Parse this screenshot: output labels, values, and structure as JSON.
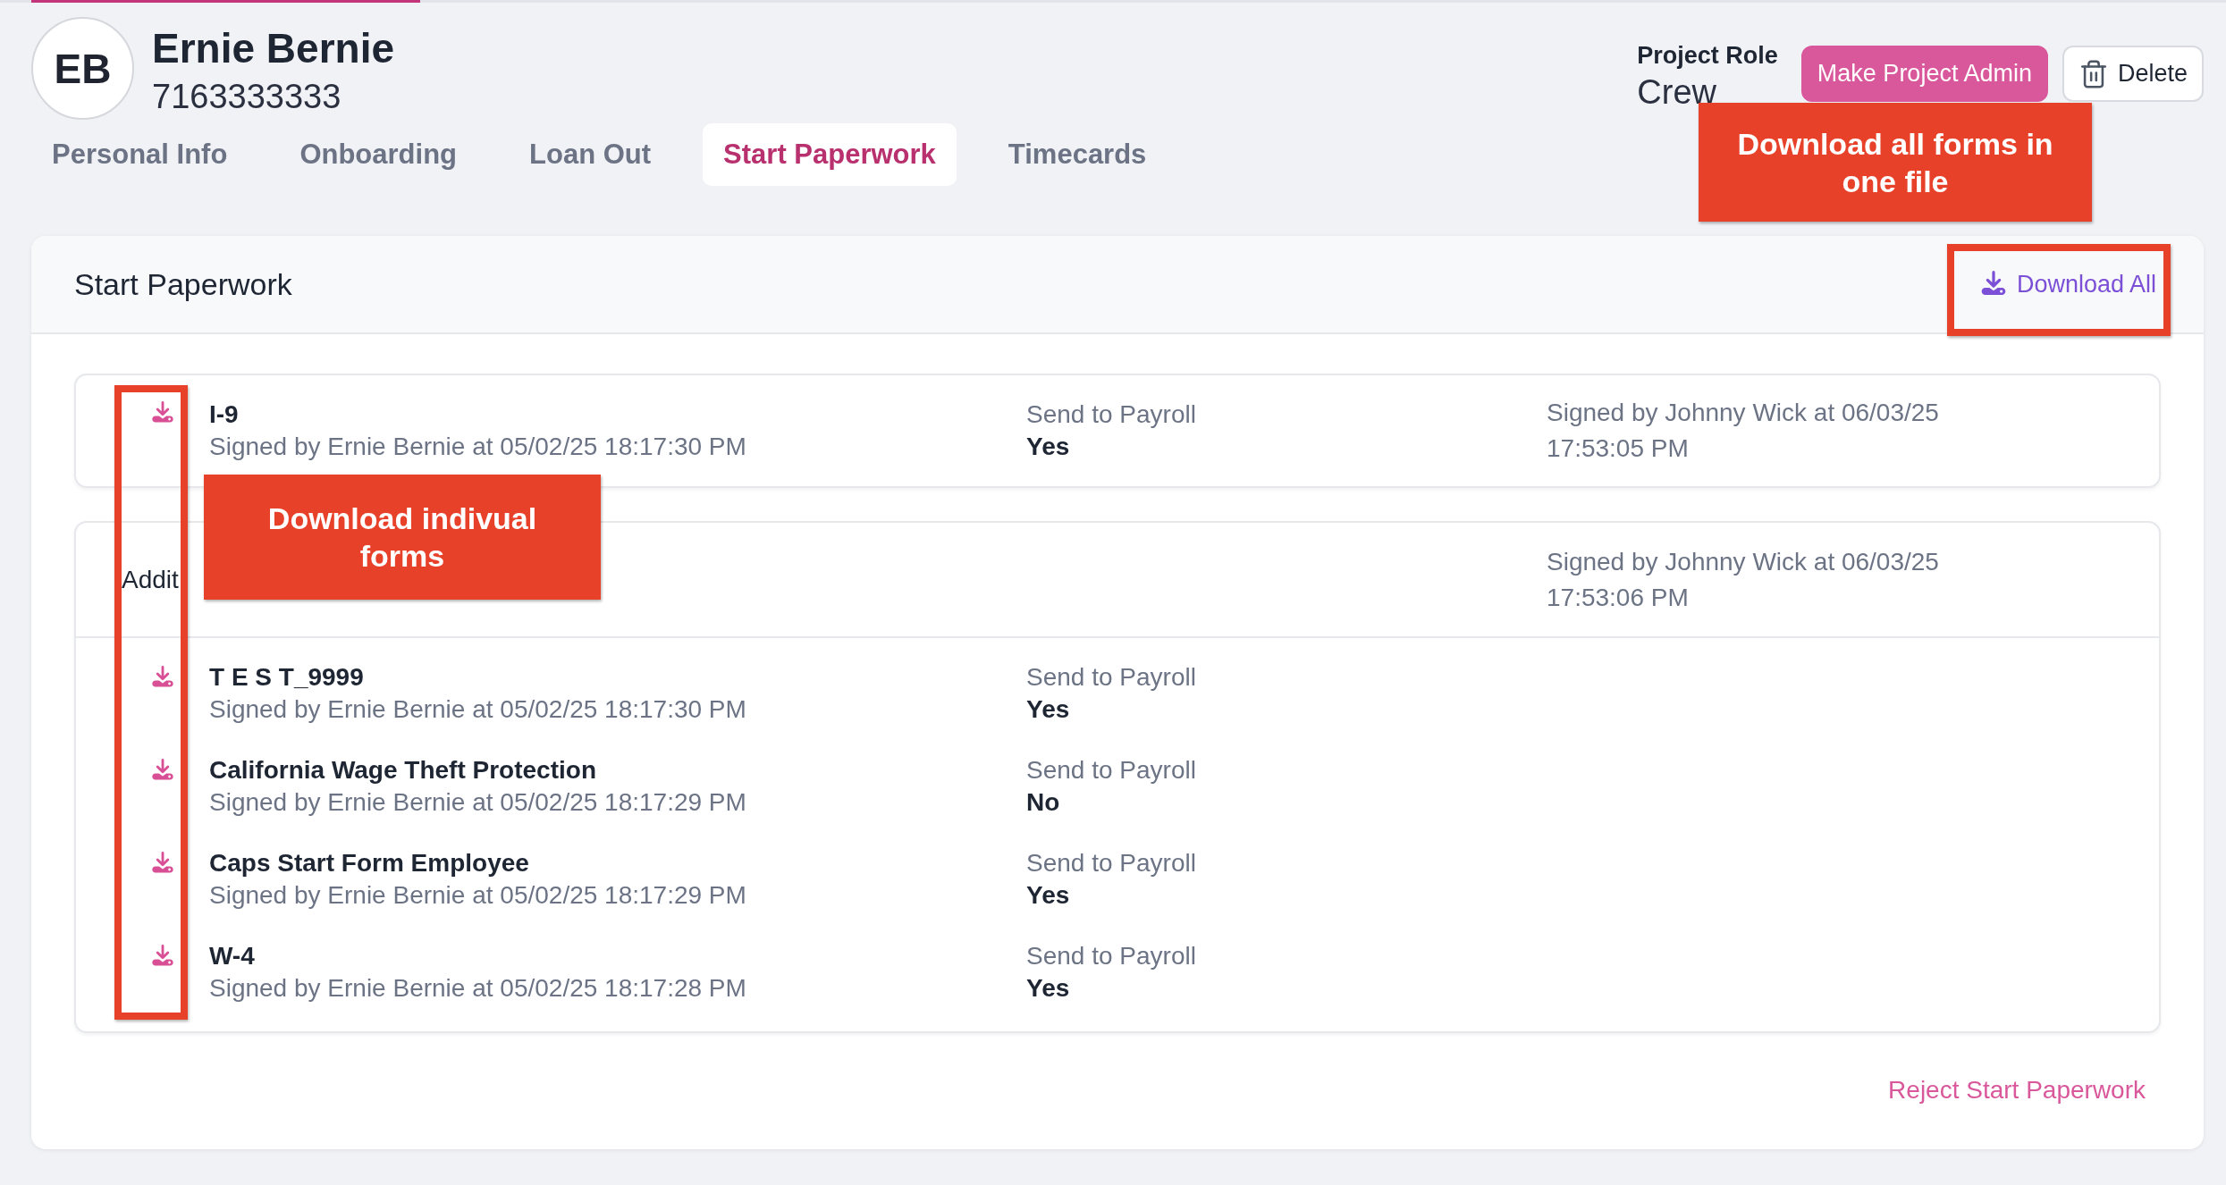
{
  "profile": {
    "initials": "EB",
    "name": "Ernie Bernie",
    "phone": "7163333333",
    "role_label": "Project Role",
    "role": "Crew"
  },
  "actions": [
    {
      "kind": "primary",
      "label": "Make Project Admin"
    },
    {
      "kind": "delete",
      "label": "Delete"
    }
  ],
  "tabs": [
    {
      "label": "Personal Info",
      "selected": false
    },
    {
      "label": "Onboarding",
      "selected": false
    },
    {
      "label": "Loan Out",
      "selected": false
    },
    {
      "label": "Start Paperwork",
      "selected": true
    },
    {
      "label": "Timecards",
      "selected": false
    }
  ],
  "panel": {
    "title": "Start Paperwork",
    "download_all": "Download All",
    "main_card": {
      "approval": "Signed by Johnny Wick at 06/03/25 17:53:05 PM",
      "forms": [
        {
          "name": "I-9",
          "signed": "Signed by Ernie Bernie at 05/02/25 18:17:30 PM",
          "payroll_label": "Send to Payroll",
          "payroll": "Yes"
        }
      ]
    },
    "additional_card": {
      "title": "Addit",
      "approval": "Signed by Johnny Wick at 06/03/25 17:53:06 PM",
      "forms": [
        {
          "name": "T E S T_9999",
          "signed": "Signed by Ernie Bernie at 05/02/25 18:17:30 PM",
          "payroll_label": "Send to Payroll",
          "payroll": "Yes"
        },
        {
          "name": "California Wage Theft Protection",
          "signed": "Signed by Ernie Bernie at 05/02/25 18:17:29 PM",
          "payroll_label": "Send to Payroll",
          "payroll": "No"
        },
        {
          "name": "Caps Start Form Employee",
          "signed": "Signed by Ernie Bernie at 05/02/25 18:17:29 PM",
          "payroll_label": "Send to Payroll",
          "payroll": "Yes"
        },
        {
          "name": "W-4",
          "signed": "Signed by Ernie Bernie at 05/02/25 18:17:28 PM",
          "payroll_label": "Send to Payroll",
          "payroll": "Yes"
        }
      ]
    },
    "reject_link": "Reject Start Paperwork"
  },
  "annotations": [
    {
      "kind": "callout",
      "text": "Download all forms in one file"
    },
    {
      "kind": "frame"
    },
    {
      "kind": "frame"
    },
    {
      "kind": "callout",
      "text": "Download indivual forms"
    }
  ]
}
